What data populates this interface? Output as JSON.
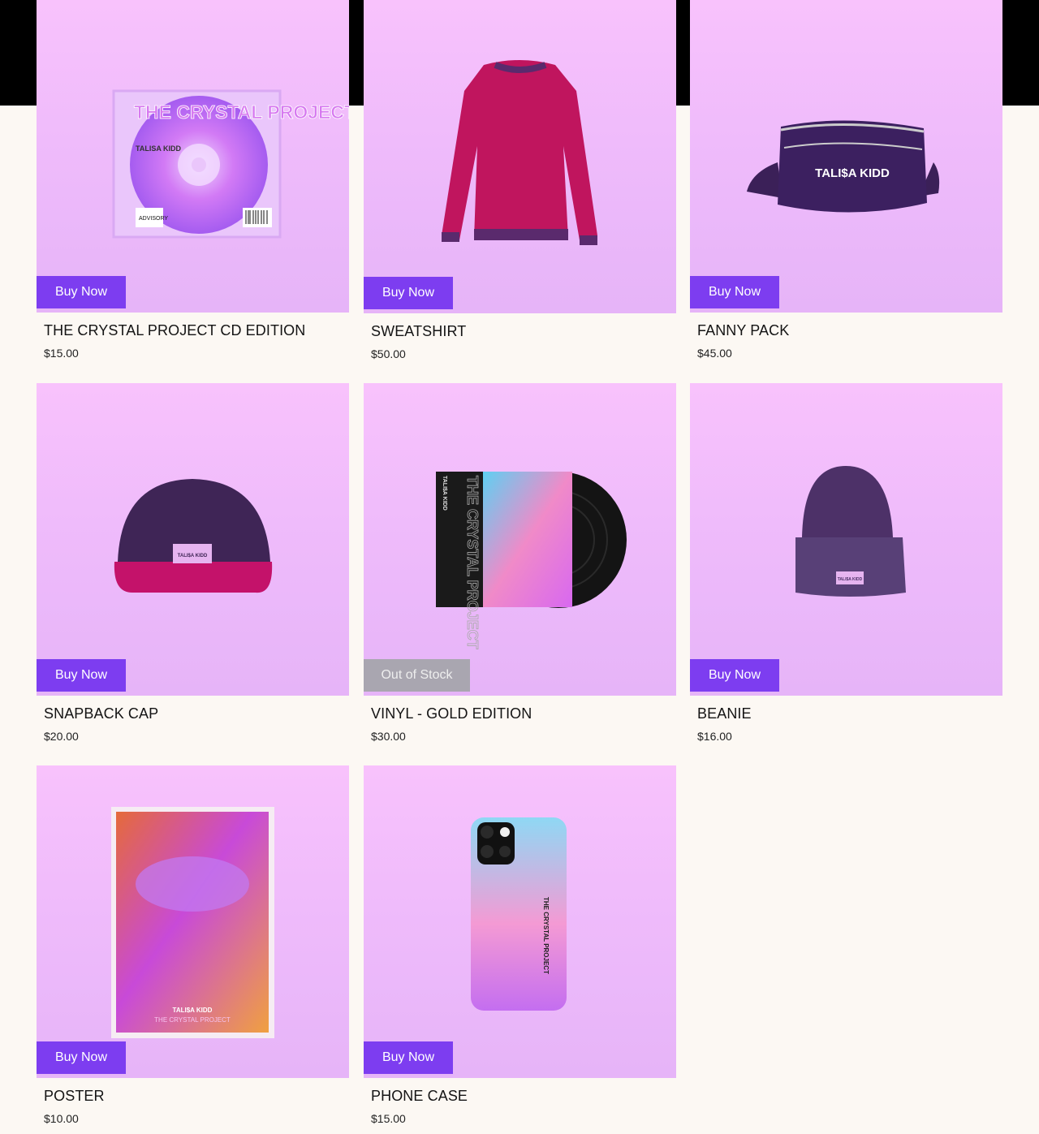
{
  "products": [
    {
      "name": "THE CRYSTAL PROJECT CD EDITION",
      "price": "$15.00",
      "button": "Buy Now",
      "art_title": "THE CRYSTAL PROJECT",
      "art_artist": "TALISA KIDD",
      "art_badge": "ADVISORY"
    },
    {
      "name": "SWEATSHIRT",
      "price": "$50.00",
      "button": "Buy Now"
    },
    {
      "name": "FANNY PACK",
      "price": "$45.00",
      "button": "Buy Now",
      "art_text": "TALI$A KIDD"
    },
    {
      "name": "SNAPBACK CAP",
      "price": "$20.00",
      "button": "Buy Now",
      "art_text": "TALI$A KIDD"
    },
    {
      "name": "VINYL - GOLD EDITION",
      "price": "$30.00",
      "button": "Out of Stock",
      "art_title": "THE CRYSTAL PROJECT",
      "art_artist": "TALI$A KIDD"
    },
    {
      "name": "BEANIE",
      "price": "$16.00",
      "button": "Buy Now",
      "art_text": "TALI$A KIDD"
    },
    {
      "name": "POSTER",
      "price": "$10.00",
      "button": "Buy Now",
      "art_artist": "TALI$A KIDD",
      "art_title": "THE CRYSTAL PROJECT"
    },
    {
      "name": "PHONE CASE",
      "price": "$15.00",
      "button": "Buy Now",
      "art_text": "THE CRYSTAL PROJECT"
    }
  ],
  "colors": {
    "button": "#7d3df0",
    "out_of_stock": "#a9a6b0",
    "background": "#fcf8f3"
  }
}
